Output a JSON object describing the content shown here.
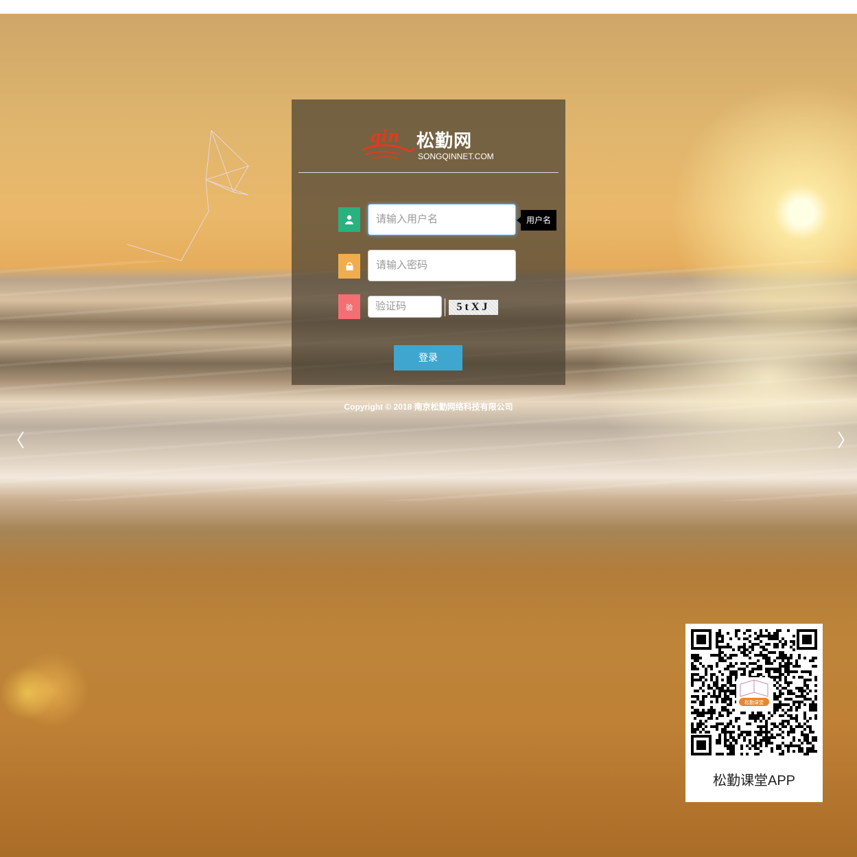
{
  "brand": {
    "name": "松勤网",
    "domain": "SONGQINNET.COM",
    "logo_mark": "qin"
  },
  "login_form": {
    "username_placeholder": "请输入用户名",
    "password_placeholder": "请输入密码",
    "captcha_placeholder": "验证码",
    "captcha_text": "5tXJ",
    "username_tooltip": "用户名",
    "captcha_icon_text": "验",
    "submit_label": "登录"
  },
  "icons": {
    "username": "user-icon",
    "password": "lock-icon",
    "captcha": "captcha-icon",
    "prev": "chevron-left-icon",
    "next": "chevron-right-icon"
  },
  "colors": {
    "username_icon_bg": "#27b27f",
    "password_icon_bg": "#f0ad4e",
    "captcha_icon_bg": "#f46f73",
    "submit_bg": "#3fa7cf"
  },
  "carousel": {
    "prev_glyph": "〈",
    "next_glyph": "〉"
  },
  "footer": {
    "copyright": "Copyright © 2018 南京松勤网络科技有限公司"
  },
  "app_promo": {
    "caption": "松勤课堂APP",
    "badge": "松勤课堂"
  }
}
